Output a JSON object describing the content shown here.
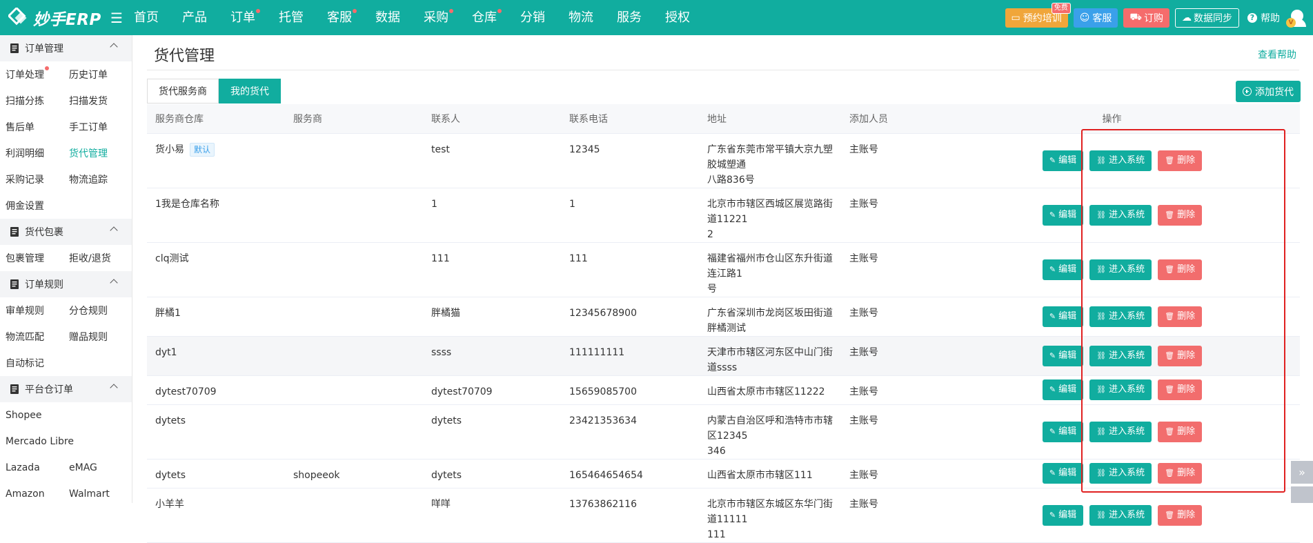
{
  "app": {
    "logo_text": "妙手ERP"
  },
  "nav": [
    {
      "label": "首页",
      "dot": false
    },
    {
      "label": "产品",
      "dot": false
    },
    {
      "label": "订单",
      "dot": true
    },
    {
      "label": "托管",
      "dot": false
    },
    {
      "label": "客服",
      "dot": true
    },
    {
      "label": "数据",
      "dot": false
    },
    {
      "label": "采购",
      "dot": true
    },
    {
      "label": "仓库",
      "dot": true
    },
    {
      "label": "分销",
      "dot": false
    },
    {
      "label": "物流",
      "dot": false
    },
    {
      "label": "服务",
      "dot": false
    },
    {
      "label": "授权",
      "dot": false
    }
  ],
  "topright": {
    "training": "预约培训",
    "training_badge": "免费",
    "service": "客服",
    "order": "订购",
    "sync": "数据同步",
    "help": "帮助",
    "avatar_badge": "V"
  },
  "sidebar": {
    "groups": [
      {
        "title": "订单管理",
        "icon": "order-doc-icon",
        "rows": [
          [
            "订单处理",
            "历史订单"
          ],
          [
            "扫描分拣",
            "扫描发货"
          ],
          [
            "售后单",
            "手工订单"
          ],
          [
            "利润明细",
            "货代管理"
          ],
          [
            "采购记录",
            "物流追踪"
          ],
          [
            "佣金设置",
            ""
          ]
        ]
      },
      {
        "title": "货代包裹",
        "icon": "package-icon",
        "rows": [
          [
            "包裹管理",
            "拒收/退货"
          ]
        ]
      },
      {
        "title": "订单规则",
        "icon": "rules-clipboard-icon",
        "rows": [
          [
            "审单规则",
            "分仓规则"
          ],
          [
            "物流匹配",
            "赠品规则"
          ],
          [
            "自动标记",
            ""
          ]
        ]
      },
      {
        "title": "平台仓订单",
        "icon": "platform-warehouse-icon",
        "rows": [
          [
            "Shopee",
            ""
          ],
          [
            "Mercado Libre",
            ""
          ],
          [
            "Lazada",
            "eMAG"
          ],
          [
            "Amazon",
            "Walmart"
          ]
        ]
      }
    ],
    "active_item": "货代管理",
    "dot_item": "订单处理"
  },
  "page": {
    "title": "货代管理",
    "help_link": "查看帮助",
    "tabs": [
      "货代服务商",
      "我的货代"
    ],
    "active_tab": 1,
    "add_button": "添加货代"
  },
  "table": {
    "columns": [
      "服务商仓库",
      "服务商",
      "联系人",
      "联系电话",
      "地址",
      "添加人员",
      "操作"
    ],
    "default_tag": "默认",
    "actions": {
      "edit": "编辑",
      "enter": "进入系统",
      "delete": "删除"
    },
    "rows": [
      {
        "warehouse": "货小易",
        "provider": "",
        "contact": "test",
        "phone": "12345",
        "address": [
          "广东省东莞市常平镇大京九塑胶城塑通",
          "八路836号"
        ],
        "adder": "主账号",
        "is_default": true
      },
      {
        "warehouse": "1我是仓库名称",
        "provider": "",
        "contact": "1",
        "phone": "1",
        "address": [
          "北京市市辖区西城区展览路街道11221",
          "2"
        ],
        "adder": "主账号",
        "is_default": false
      },
      {
        "warehouse": "clq测试",
        "provider": "",
        "contact": "111",
        "phone": "111",
        "address": [
          "福建省福州市仓山区东升街道连江路1",
          "号"
        ],
        "adder": "主账号",
        "is_default": false
      },
      {
        "warehouse": "胖橘1",
        "provider": "",
        "contact": "胖橘猫",
        "phone": "12345678900",
        "address": [
          "广东省深圳市龙岗区坂田街道胖橘测试"
        ],
        "adder": "主账号",
        "is_default": false
      },
      {
        "warehouse": "dyt1",
        "provider": "",
        "contact": "ssss",
        "phone": "111111111",
        "address": [
          "天津市市辖区河东区中山门街道ssss"
        ],
        "adder": "主账号",
        "is_default": false
      },
      {
        "warehouse": "dytest70709",
        "provider": "",
        "contact": "dytest70709",
        "phone": "15659085700",
        "address": [
          "山西省太原市市辖区11222"
        ],
        "adder": "主账号",
        "is_default": false
      },
      {
        "warehouse": "dytets",
        "provider": "",
        "contact": "dytets",
        "phone": "23421353634",
        "address": [
          "内蒙古自治区呼和浩特市市辖区12345",
          "346"
        ],
        "adder": "主账号",
        "is_default": false
      },
      {
        "warehouse": "dytets",
        "provider": "shopeeok",
        "contact": "dytets",
        "phone": "165464654654",
        "address": [
          "山西省太原市市辖区111"
        ],
        "adder": "主账号",
        "is_default": false
      },
      {
        "warehouse": "小羊羊",
        "provider": "",
        "contact": "咩咩",
        "phone": "13763862116",
        "address": [
          "北京市市辖区东城区东华门街道11111",
          "111"
        ],
        "adder": "主账号",
        "is_default": false
      }
    ]
  },
  "colors": {
    "brand": "#11ad9f",
    "danger": "#f26d6d",
    "highlight": "#e02020"
  }
}
